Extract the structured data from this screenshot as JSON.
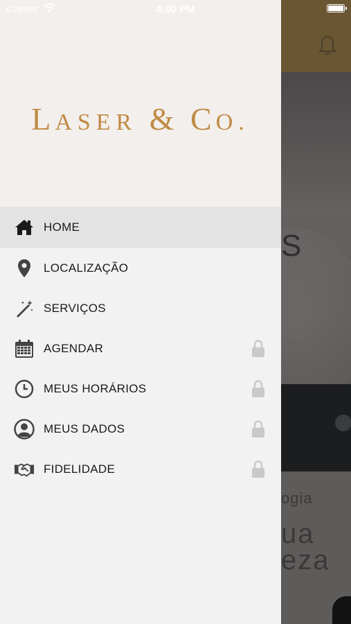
{
  "status_bar": {
    "carrier": "Carrier",
    "time": "4:00 PM"
  },
  "brand": {
    "first_initial": "L",
    "first_rest": "ASER",
    "ampersand": "&",
    "second_initial": "C",
    "second_rest": "O."
  },
  "menu": {
    "items": [
      {
        "label": "HOME",
        "icon": "home-icon",
        "locked": false,
        "active": true
      },
      {
        "label": "LOCALIZAÇÃO",
        "icon": "location-pin-icon",
        "locked": false,
        "active": false
      },
      {
        "label": "SERVIÇOS",
        "icon": "magic-wand-icon",
        "locked": false,
        "active": false
      },
      {
        "label": "AGENDAR",
        "icon": "calendar-icon",
        "locked": true,
        "active": false
      },
      {
        "label": "MEUS HORÁRIOS",
        "icon": "clock-icon",
        "locked": true,
        "active": false
      },
      {
        "label": "MEUS DADOS",
        "icon": "user-icon",
        "locked": true,
        "active": false
      },
      {
        "label": "FIDELIDADE",
        "icon": "handshake-icon",
        "locked": true,
        "active": false
      }
    ]
  },
  "background_screen": {
    "hero_fragment": "S",
    "card_line1": "ogia",
    "card_line2": "ua",
    "card_line3": "eza"
  },
  "colors": {
    "brand_gold": "#c08a45",
    "drawer_bg": "#f2f2f2",
    "drawer_header_bg": "#f3efec",
    "active_item_bg": "#e3e3e3",
    "lock_gray": "#c9c9c9"
  }
}
